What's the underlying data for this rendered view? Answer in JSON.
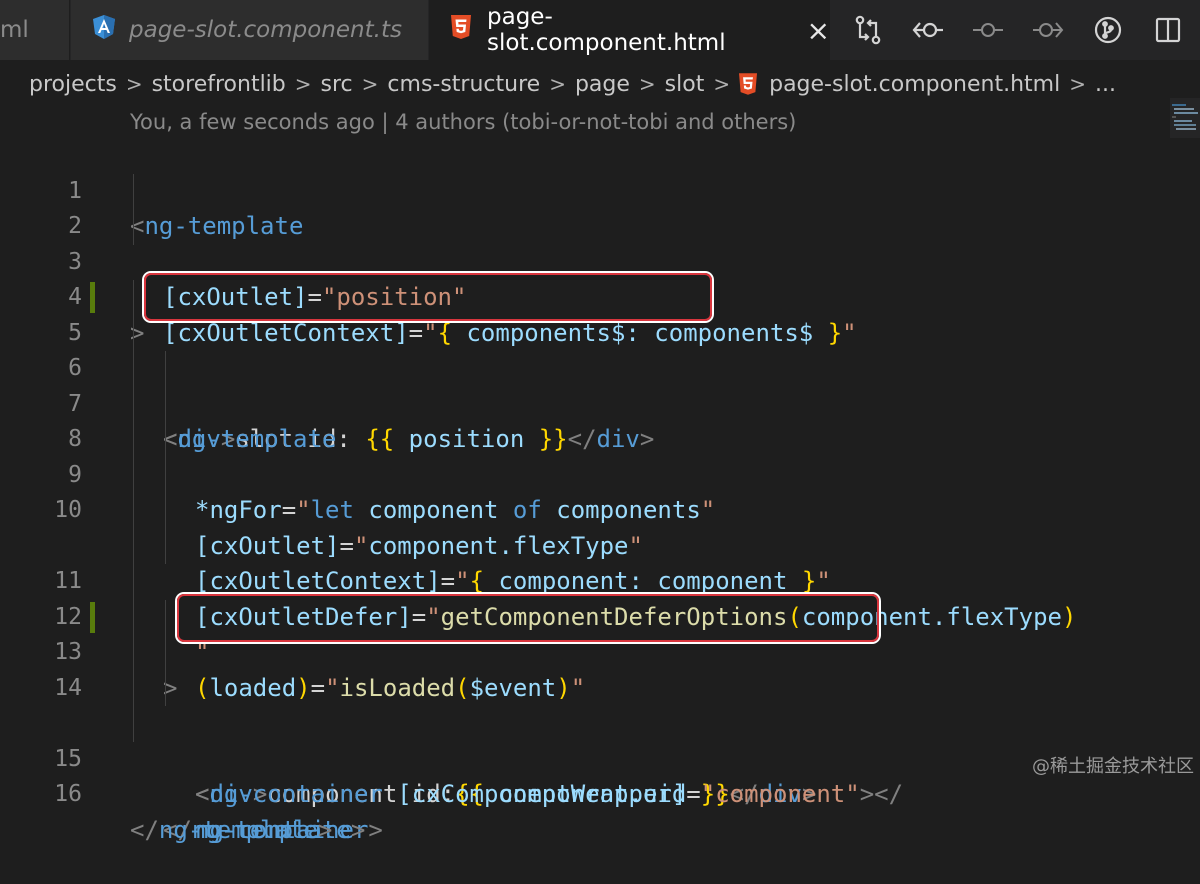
{
  "tabs": {
    "partial_label": "ml",
    "ts_label": "page-slot.component.ts",
    "active_label": "page-slot.component.html",
    "close_glyph": "×"
  },
  "actions": [
    "compare-changes-icon",
    "previous-change-icon",
    "timeline-icon",
    "next-change-icon",
    "git-graph-icon",
    "split-editor-icon"
  ],
  "breadcrumb": {
    "items": [
      "projects",
      "storefrontlib",
      "src",
      "cms-structure",
      "page",
      "slot",
      "page-slot.component.html",
      "..."
    ],
    "separator": ">"
  },
  "blame": "You, a few seconds ago | 4 authors (tobi-or-not-tobi and others)",
  "lines": [
    {
      "n": "1"
    },
    {
      "n": "2"
    },
    {
      "n": "3"
    },
    {
      "n": "4"
    },
    {
      "n": "5"
    },
    {
      "n": "6"
    },
    {
      "n": "7"
    },
    {
      "n": "8"
    },
    {
      "n": "9"
    },
    {
      "n": "10"
    },
    {
      "n": ""
    },
    {
      "n": "11"
    },
    {
      "n": "12"
    },
    {
      "n": "13"
    },
    {
      "n": "14"
    },
    {
      "n": ""
    },
    {
      "n": "15"
    },
    {
      "n": "16"
    }
  ],
  "code": {
    "l1": {
      "lt": "<",
      "tag": "ng-template"
    },
    "l2": {
      "b1": "[",
      "attr": "cxOutlet",
      "b2": "]",
      "eq": "=",
      "val": "\"position\""
    },
    "l3": {
      "b1": "[",
      "attr": "cxOutletContext",
      "b2": "]",
      "eq": "=",
      "q1": "\"",
      "ob": "{",
      "text": " components$: components$ ",
      "cb": "}",
      "q2": "\""
    },
    "l4": {
      "gt": ">"
    },
    "l5": {
      "lt": "<",
      "tag": "div",
      "gt": ">",
      "text": "slot id: ",
      "ob": "{{",
      "expr": " position ",
      "cb": "}}",
      "clt": "</",
      "ctag": "div",
      "cgt": ">"
    },
    "l6": {
      "lt": "<",
      "tag": "ng-template"
    },
    "l7": {
      "attr": "*ngFor",
      "eq": "=",
      "q1": "\"",
      "kw1": "let",
      "t1": " component ",
      "kw2": "of",
      "t2": " components",
      "q2": "\""
    },
    "l8": {
      "b1": "[",
      "attr": "cxOutlet",
      "b2": "]",
      "eq": "=",
      "q1": "\"",
      "text": "component.flexType",
      "q2": "\""
    },
    "l9": {
      "b1": "[",
      "attr": "cxOutletContext",
      "b2": "]",
      "eq": "=",
      "q1": "\"",
      "ob": "{",
      "text": " component: component ",
      "cb": "}",
      "q2": "\""
    },
    "l10": {
      "b1": "[",
      "attr": "cxOutletDefer",
      "b2": "]",
      "eq": "=",
      "q1": "\"",
      "fn": "getComponentDeferOptions",
      "op": "(",
      "text": "component.flexType",
      "cp": ")"
    },
    "l10b": {
      "q2": "\""
    },
    "l11": {
      "p1": "(",
      "attr": "loaded",
      "p2": ")",
      "eq": "=",
      "q1": "\"",
      "fn": "isLoaded",
      "op": "(",
      "text": "$event",
      "cp": ")",
      "q2": "\""
    },
    "l12": {
      "gt": ">"
    },
    "l13": {
      "lt": "<",
      "tag": "div",
      "gt": ">",
      "text": "component id:",
      "ob": "{{",
      "expr": " component.uid ",
      "cb": "}}",
      "clt": "</",
      "ctag": "div",
      "cgt": ">"
    },
    "l14": {
      "lt": "<",
      "tag": "ng-container",
      "sp": " ",
      "b1": "[",
      "attr": "cxComponentWrapper",
      "b2": "]",
      "eq": "=",
      "val": "\"component\"",
      "gt": ">",
      "clt": "</"
    },
    "l14b": {
      "tag": "ng-container",
      "gt": ">"
    },
    "l15": {
      "clt": "</",
      "tag": "ng-template",
      "gt": ">"
    },
    "l16": {
      "clt": "</",
      "tag": "ng-template",
      "gt": ">"
    }
  },
  "watermark": "@稀土掘金技术社区",
  "colors": {
    "editor_bg": "#1e1e1e",
    "tag": "#569cd6",
    "attribute": "#9cdcfe",
    "string": "#ce9178",
    "highlight_box": "#d9363e",
    "git_modified": "#587c0c"
  }
}
